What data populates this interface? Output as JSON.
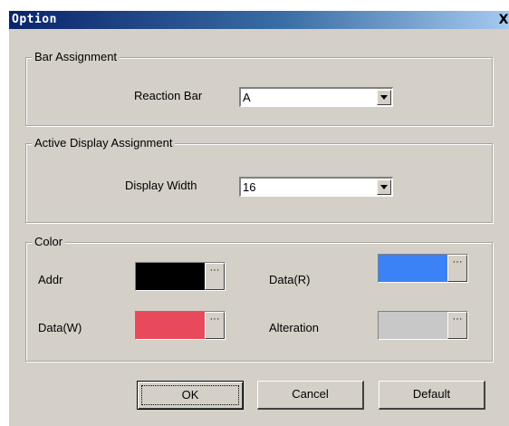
{
  "window": {
    "title": "Option",
    "close_glyph": "X"
  },
  "bar_assignment": {
    "legend": "Bar Assignment",
    "reaction_bar_label": "Reaction Bar",
    "reaction_bar_value": "A"
  },
  "active_display": {
    "legend": "Active Display Assignment",
    "display_width_label": "Display Width",
    "display_width_value": "16"
  },
  "color": {
    "legend": "Color",
    "addr": {
      "label": "Addr",
      "color": "#000000"
    },
    "data_r": {
      "label": "Data(R)",
      "color": "#3a82f6"
    },
    "data_w": {
      "label": "Data(W)",
      "color": "#e84a5b"
    },
    "alteration": {
      "label": "Alteration",
      "color": "#c8c8c8"
    },
    "picker_glyph": "···"
  },
  "buttons": {
    "ok": "OK",
    "cancel": "Cancel",
    "default": "Default"
  }
}
